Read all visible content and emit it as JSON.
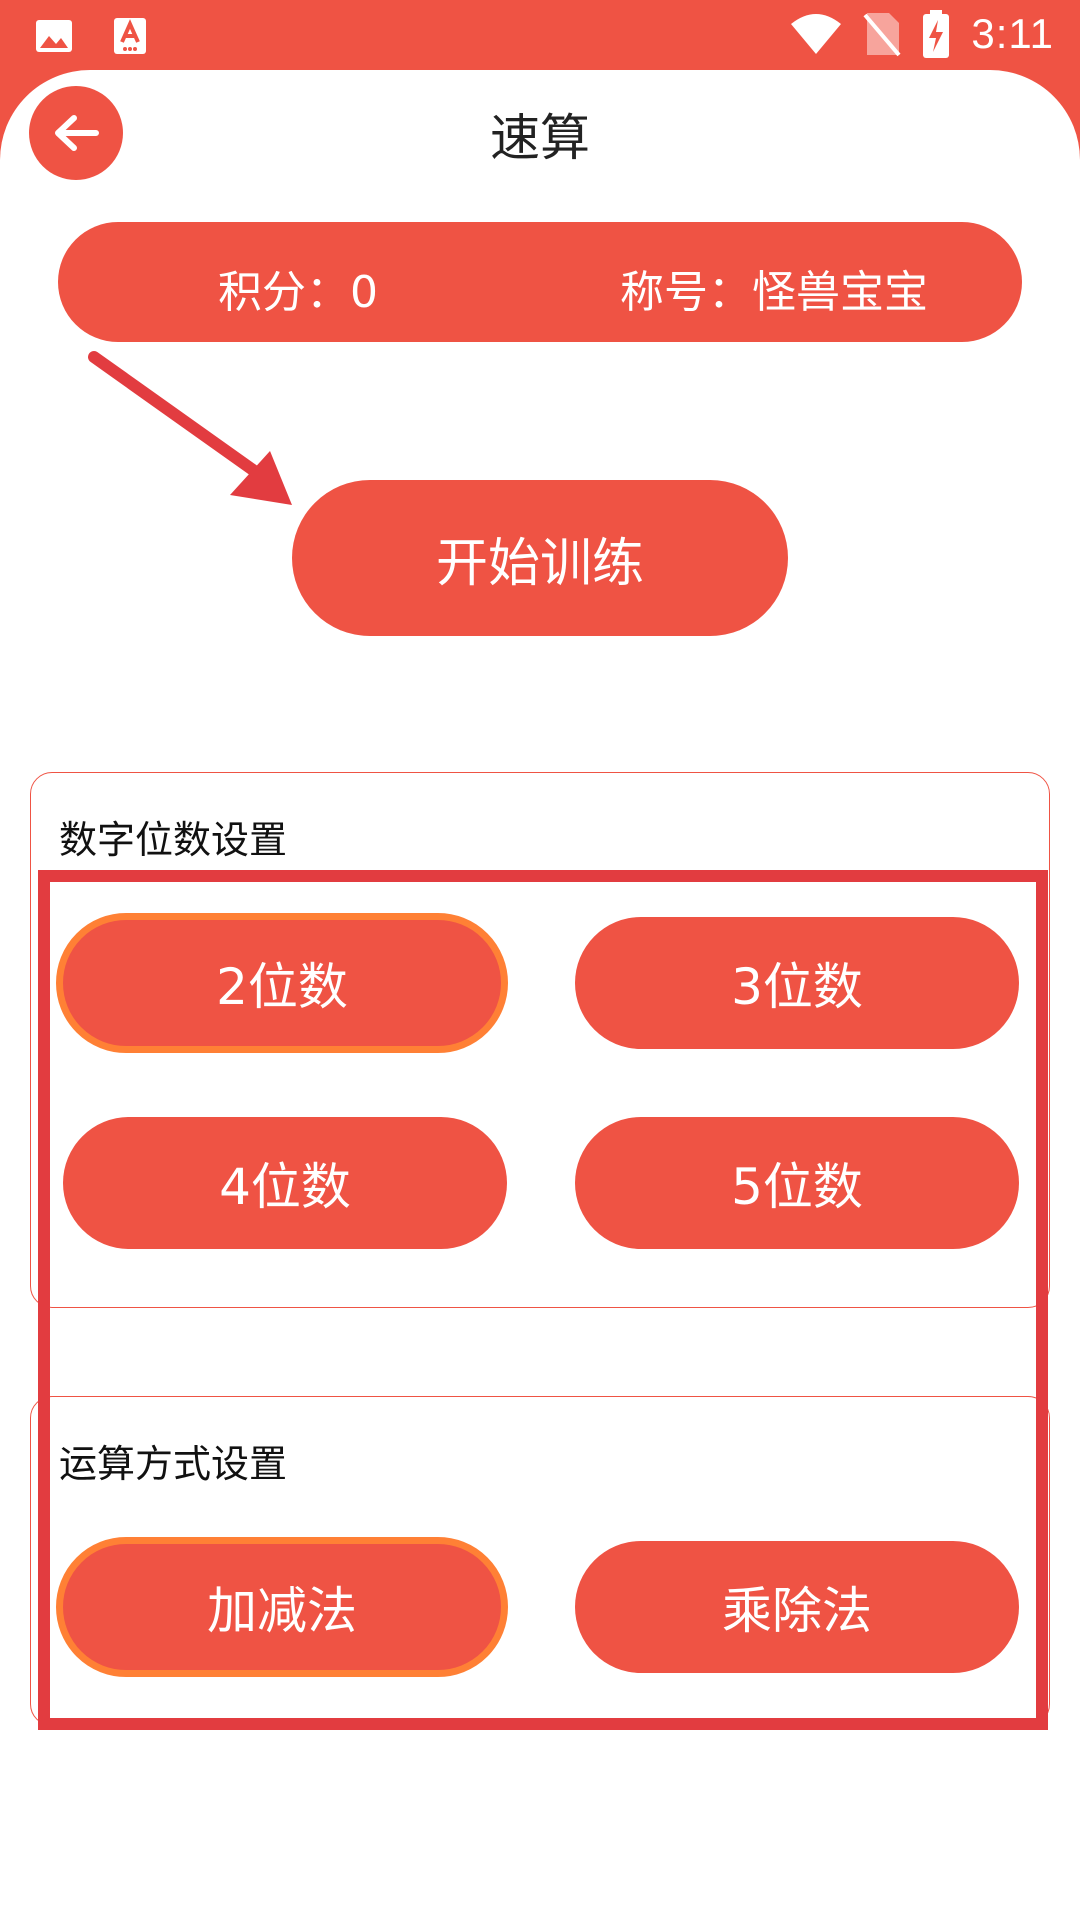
{
  "status_bar": {
    "time": "3:11",
    "icons": [
      "image-icon",
      "a-note-icon",
      "wifi-icon",
      "no-sim-icon",
      "battery-charging-icon"
    ]
  },
  "header": {
    "title": "速算",
    "back_icon": "arrow-left-icon"
  },
  "score_bar": {
    "score": "积分：0",
    "rank": "称号：怪兽宝宝"
  },
  "start_button": {
    "label": "开始训练"
  },
  "digits_settings": {
    "label": "数字位数设置",
    "options": [
      {
        "label": "2位数",
        "selected": true
      },
      {
        "label": "3位数",
        "selected": false
      },
      {
        "label": "4位数",
        "selected": false
      },
      {
        "label": "5位数",
        "selected": false
      }
    ]
  },
  "operation_settings": {
    "label": "运算方式设置",
    "options": [
      {
        "label": "加减法",
        "selected": true
      },
      {
        "label": "乘除法",
        "selected": false
      }
    ]
  },
  "colors": {
    "primary": "#EF5344",
    "selected_border": "#FF8035",
    "annotation": "#E23C40"
  }
}
